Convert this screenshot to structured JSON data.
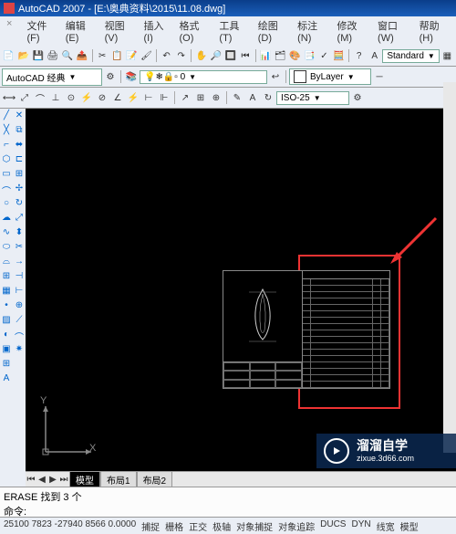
{
  "title": "AutoCAD 2007 - [E:\\奥典资料\\2015\\11.08.dwg]",
  "menu": [
    "文件(F)",
    "编辑(E)",
    "视图(V)",
    "插入(I)",
    "格式(O)",
    "工具(T)",
    "绘图(D)",
    "标注(N)",
    "修改(M)",
    "窗口(W)",
    "帮助(H)"
  ],
  "workspace": "AutoCAD 经典",
  "style_dropdown": "Standard",
  "layer_dropdown": "ByLayer",
  "dimstyle": "ISO-25",
  "tabs": {
    "active": "模型",
    "others": [
      "布局1",
      "布局2"
    ]
  },
  "command": {
    "line1": "ERASE 找到 3 个",
    "line2": "命令:"
  },
  "status": {
    "coords": "25100 7823  -27940 8566  0.0000",
    "buttons": [
      "捕捉",
      "栅格",
      "正交",
      "极轴",
      "对象捕捉",
      "对象追踪",
      "DUCS",
      "DYN",
      "线宽",
      "模型"
    ]
  },
  "ucs": {
    "x": "X",
    "y": "Y"
  },
  "watermark": {
    "title": "溜溜自学",
    "url": "zixue.3d66.com"
  }
}
